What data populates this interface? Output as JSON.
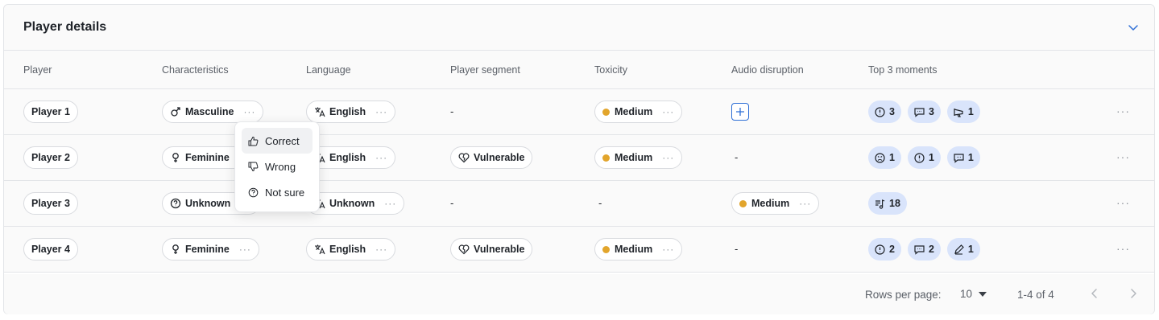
{
  "card": {
    "title": "Player details"
  },
  "columns": [
    "Player",
    "Characteristics",
    "Language",
    "Player segment",
    "Toxicity",
    "Audio disruption",
    "Top 3 moments"
  ],
  "rows": [
    {
      "player": "Player 1",
      "characteristic": {
        "label": "Masculine",
        "icon": "male-icon"
      },
      "language": "English",
      "segment": null,
      "segment_dash": "-",
      "toxicity": "Medium",
      "audio": null,
      "moments": [
        {
          "icon": "alert-icon",
          "count": "3"
        },
        {
          "icon": "chat-icon",
          "count": "3"
        },
        {
          "icon": "megaphone-icon",
          "count": "1"
        }
      ]
    },
    {
      "player": "Player 2",
      "characteristic": {
        "label": "Feminine",
        "icon": "female-icon"
      },
      "language": "English",
      "segment": "Vulnerable",
      "toxicity": "Medium",
      "audio_dash": "-",
      "moments": [
        {
          "icon": "frown-icon",
          "count": "1"
        },
        {
          "icon": "alert-icon",
          "count": "1"
        },
        {
          "icon": "chat-icon",
          "count": "1"
        }
      ]
    },
    {
      "player": "Player 3",
      "characteristic": {
        "label": "Unknown",
        "icon": "unknown-gender-icon"
      },
      "language": "Unknown",
      "segment_dash": "-",
      "toxicity_dash": "-",
      "audio": "Medium",
      "moments": [
        {
          "icon": "music-icon",
          "count": "18"
        }
      ]
    },
    {
      "player": "Player 4",
      "characteristic": {
        "label": "Feminine",
        "icon": "female-icon"
      },
      "language": "English",
      "segment": "Vulnerable",
      "toxicity": "Medium",
      "audio_dash": "-",
      "moments": [
        {
          "icon": "alert-icon",
          "count": "2"
        },
        {
          "icon": "chat-icon",
          "count": "2"
        },
        {
          "icon": "pen-icon",
          "count": "1"
        }
      ]
    }
  ],
  "feedback_menu": {
    "items": [
      "Correct",
      "Wrong",
      "Not sure"
    ]
  },
  "pagination": {
    "rows_per_page_label": "Rows per page:",
    "rows_per_page_value": "10",
    "range": "1-4 of 4"
  },
  "colors": {
    "accent": "#2f6fd6",
    "medium_dot": "#e2a52c",
    "moment_bg": "#d9e4fb"
  }
}
